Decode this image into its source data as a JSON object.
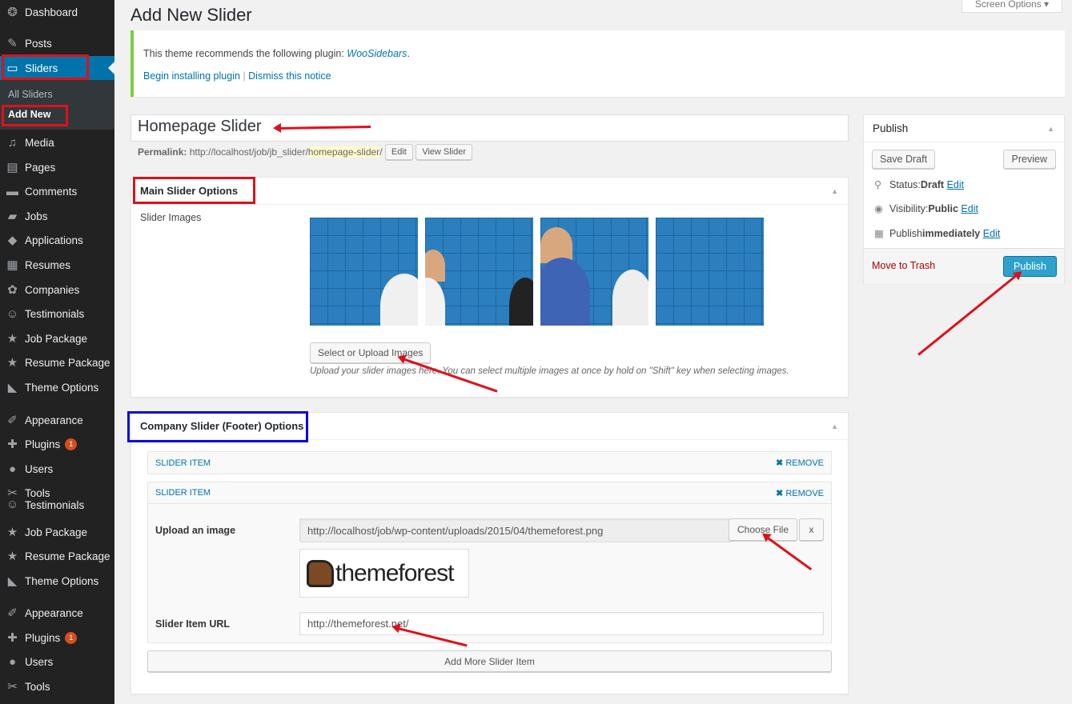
{
  "sidebar": {
    "items": [
      {
        "label": "Dashboard",
        "icon": "dashboard-icon",
        "glyph": "❂"
      },
      {
        "label": "Posts",
        "icon": "pin-icon",
        "glyph": "✎"
      },
      {
        "label": "Sliders",
        "icon": "slides-icon",
        "glyph": "▭"
      },
      {
        "label": "Media",
        "icon": "media-icon",
        "glyph": "♫"
      },
      {
        "label": "Pages",
        "icon": "pages-icon",
        "glyph": "▤"
      },
      {
        "label": "Comments",
        "icon": "comments-icon",
        "glyph": "▬"
      },
      {
        "label": "Jobs",
        "icon": "folder-icon",
        "glyph": "▰"
      },
      {
        "label": "Applications",
        "icon": "hammer-icon",
        "glyph": "◆"
      },
      {
        "label": "Resumes",
        "icon": "id-card-icon",
        "glyph": "▦"
      },
      {
        "label": "Companies",
        "icon": "groups-icon",
        "glyph": "✿"
      },
      {
        "label": "Testimonials",
        "icon": "smiley-icon",
        "glyph": "☺"
      },
      {
        "label": "Job Package",
        "icon": "star-icon",
        "glyph": "★"
      },
      {
        "label": "Resume Package",
        "icon": "star-icon",
        "glyph": "★"
      },
      {
        "label": "Theme Options",
        "icon": "chart-icon",
        "glyph": "◣"
      },
      {
        "label": "Appearance",
        "icon": "paintbrush-icon",
        "glyph": "✐"
      },
      {
        "label": "Plugins",
        "icon": "plugin-icon",
        "glyph": "✚",
        "badge": "1"
      },
      {
        "label": "Users",
        "icon": "user-icon",
        "glyph": "●"
      },
      {
        "label": "Tools",
        "icon": "wrench-icon",
        "glyph": "✂"
      },
      {
        "label": "Testimonials",
        "icon": "smiley-icon",
        "glyph": "☺"
      },
      {
        "label": "Job Package",
        "icon": "star-icon",
        "glyph": "★"
      },
      {
        "label": "Resume Package",
        "icon": "star-icon",
        "glyph": "★"
      },
      {
        "label": "Theme Options",
        "icon": "chart-icon",
        "glyph": "◣"
      },
      {
        "label": "Appearance",
        "icon": "paintbrush-icon",
        "glyph": "✐"
      },
      {
        "label": "Plugins",
        "icon": "plugin-icon",
        "glyph": "✚",
        "badge": "1"
      },
      {
        "label": "Users",
        "icon": "user-icon",
        "glyph": "●"
      },
      {
        "label": "Tools",
        "icon": "wrench-icon",
        "glyph": "✂"
      }
    ],
    "submenu": {
      "all": "All Sliders",
      "add": "Add New"
    }
  },
  "header": {
    "title": "Add New Slider",
    "screen_options": "Screen Options"
  },
  "notice": {
    "text": "This theme recommends the following plugin: ",
    "plugin": "WooSidebars",
    "period": ".",
    "begin": "Begin installing plugin",
    "sep": "|",
    "dismiss": "Dismiss this notice"
  },
  "post": {
    "title": "Homepage Slider",
    "permalink_label": "Permalink:",
    "permalink_base": "http://localhost/job/jb_slider/",
    "permalink_slug": "homepage-slider",
    "permalink_end": "/",
    "edit": "Edit",
    "view": "View Slider"
  },
  "main_options": {
    "title": "Main Slider Options",
    "images_label": "Slider Images",
    "upload_button": "Select or Upload Images",
    "help": "Upload your slider images here. You can select multiple images at once by hold on \"Shift\" key when selecting images."
  },
  "company": {
    "title": "Company Slider (Footer) Options",
    "item_label": "SLIDER ITEM",
    "remove": "REMOVE",
    "upload_label": "Upload an image",
    "image_url": "http://localhost/job/wp-content/uploads/2015/04/themeforest.png",
    "choose": "Choose File",
    "clear": "x",
    "logo_text": "themeforest",
    "url_label": "Slider Item URL",
    "url_value": "http://themeforest.net/",
    "add_more": "Add More Slider Item"
  },
  "publish": {
    "title": "Publish",
    "save_draft": "Save Draft",
    "preview": "Preview",
    "status_label": "Status: ",
    "status_value": "Draft",
    "visibility_label": "Visibility: ",
    "visibility_value": "Public",
    "publish_label": "Publish ",
    "publish_value": "immediately",
    "edit": "Edit",
    "trash": "Move to Trash",
    "publish_button": "Publish"
  },
  "colors": {
    "accent": "#0073aa",
    "annotation_red": "#e0101a",
    "annotation_blue": "#0a0ad8",
    "sidebar": "#222222"
  }
}
